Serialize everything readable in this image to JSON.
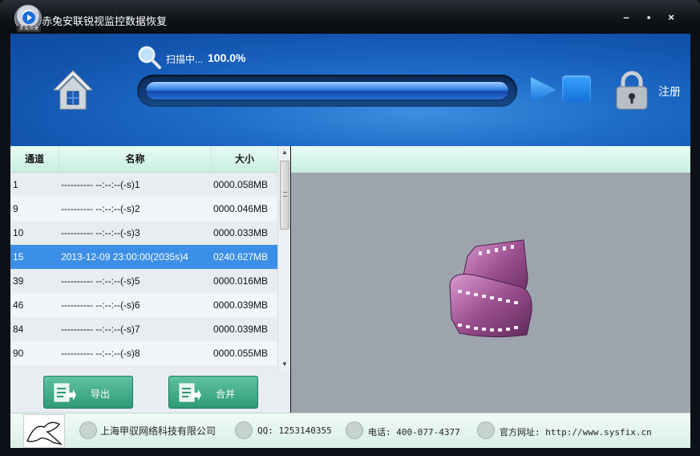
{
  "window": {
    "title": "赤兔安联锐视监控数据恢复",
    "logo_tag": "赤兔快捷",
    "controls": {
      "minimize": "–",
      "maximize": "▪",
      "close": "×"
    }
  },
  "header": {
    "scan_label": "扫描中...",
    "scan_percent": "100.0%",
    "progress": 1.0,
    "register": "注册"
  },
  "table": {
    "columns": [
      "通道",
      "名称",
      "大小"
    ],
    "rows": [
      {
        "channel": "1",
        "name": "---------- --:--:--(-s)1",
        "size": "0000.058MB"
      },
      {
        "channel": "9",
        "name": "---------- --:--:--(-s)2",
        "size": "0000.046MB"
      },
      {
        "channel": "10",
        "name": "---------- --:--:--(-s)3",
        "size": "0000.033MB"
      },
      {
        "channel": "15",
        "name": "2013-12-09 23:00:00(2035s)4",
        "size": "0240.627MB"
      },
      {
        "channel": "39",
        "name": "---------- --:--:--(-s)5",
        "size": "0000.016MB"
      },
      {
        "channel": "46",
        "name": "---------- --:--:--(-s)6",
        "size": "0000.039MB"
      },
      {
        "channel": "84",
        "name": "---------- --:--:--(-s)7",
        "size": "0000.039MB"
      },
      {
        "channel": "90",
        "name": "---------- --:--:--(-s)8",
        "size": "0000.055MB"
      }
    ],
    "selected_index": 3
  },
  "buttons": {
    "export": "导出",
    "merge": "合并"
  },
  "footer": {
    "company": "上海甲驭网络科技有限公司",
    "qq": "QQ: 1253140355",
    "phone": "电话: 400-077-4377",
    "website": "官方网址: http://www.sysfix.cn"
  },
  "colors": {
    "accent": "#1f6dc8",
    "selected_row": "#3c8fe6",
    "button_green": "#2f9a78"
  }
}
